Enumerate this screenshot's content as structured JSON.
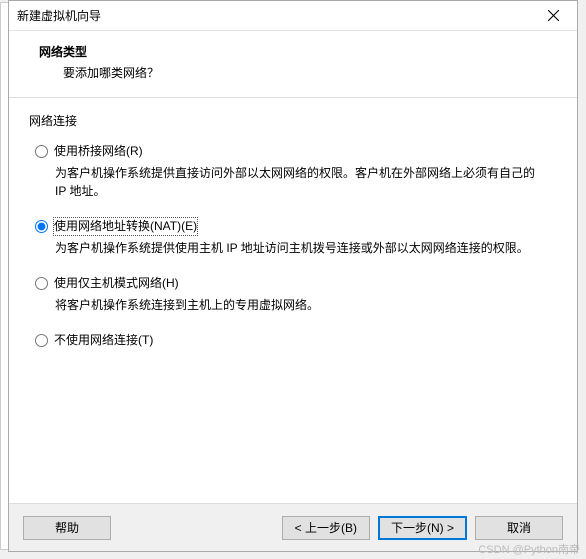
{
  "titlebar": {
    "title": "新建虚拟机向导"
  },
  "header": {
    "title": "网络类型",
    "subtitle": "要添加哪类网络？"
  },
  "group": {
    "label": "网络连接"
  },
  "options": {
    "bridged": {
      "label": "使用桥接网络(R)",
      "desc": "为客户机操作系统提供直接访问外部以太网网络的权限。客户机在外部网络上必须有自己的 IP 地址。"
    },
    "nat": {
      "label": "使用网络地址转换(NAT)(E)",
      "desc": "为客户机操作系统提供使用主机 IP 地址访问主机拨号连接或外部以太网网络连接的权限。"
    },
    "hostonly": {
      "label": "使用仅主机模式网络(H)",
      "desc": "将客户机操作系统连接到主机上的专用虚拟网络。"
    },
    "none": {
      "label": "不使用网络连接(T)"
    }
  },
  "buttons": {
    "help": "帮助",
    "back": "< 上一步(B)",
    "next": "下一步(N) >",
    "cancel": "取消"
  },
  "watermark": "CSDN @Python南帝"
}
